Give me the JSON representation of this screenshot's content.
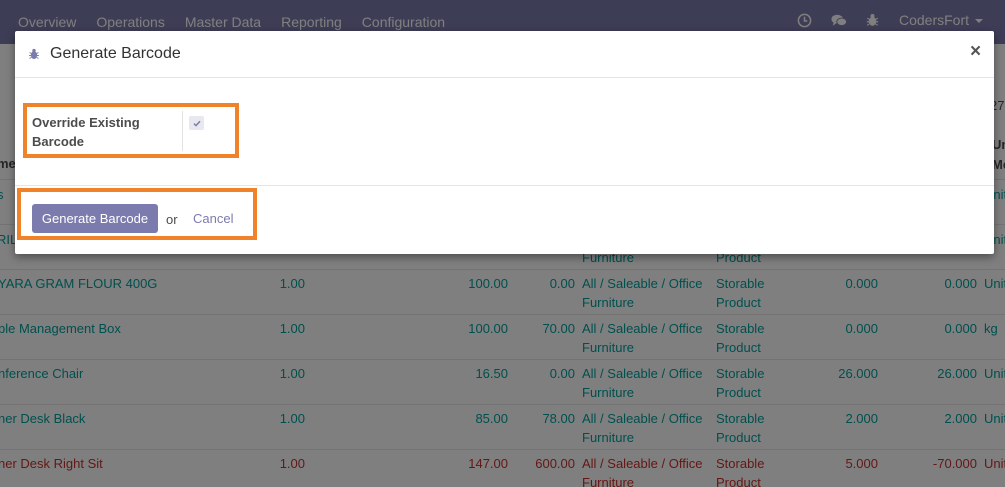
{
  "navbar": {
    "menu": [
      "Overview",
      "Operations",
      "Master Data",
      "Reporting",
      "Configuration"
    ],
    "user": "CodersFort"
  },
  "background": {
    "control_panel_fragment": "27",
    "header_fragments": {
      "left": "me",
      "right_top": "Uni",
      "right_bottom": "Mea"
    },
    "rows_fragments": [
      {
        "col_left": "s",
        "col_right": "Unit"
      },
      {
        "col_left": "RIL",
        "col_right": "Unit",
        "categ_2": "Furniture",
        "type_2": "Product"
      }
    ],
    "rows": [
      {
        "name": "YARA GRAM FLOUR 400G",
        "qty": "1.00",
        "price": "100.00",
        "cost": "0.00",
        "categ_1": "All / Saleable / Office",
        "categ_2": "Furniture",
        "type_1": "Storable",
        "type_2": "Product",
        "onhand": "0.000",
        "forecast": "0.000",
        "uom": "Unit",
        "red": false
      },
      {
        "name": "ble Management Box",
        "qty": "1.00",
        "price": "100.00",
        "cost": "70.00",
        "categ_1": "All / Saleable / Office",
        "categ_2": "Furniture",
        "type_1": "Storable",
        "type_2": "Product",
        "onhand": "0.000",
        "forecast": "0.000",
        "uom": "kg",
        "red": false
      },
      {
        "name": "nference Chair",
        "qty": "1.00",
        "price": "16.50",
        "cost": "0.00",
        "categ_1": "All / Saleable / Office",
        "categ_2": "Furniture",
        "type_1": "Storable",
        "type_2": "Product",
        "onhand": "26.000",
        "forecast": "26.000",
        "uom": "Unit",
        "red": false
      },
      {
        "name": "ner Desk Black",
        "qty": "1.00",
        "price": "85.00",
        "cost": "78.00",
        "categ_1": "All / Saleable / Office",
        "categ_2": "Furniture",
        "type_1": "Storable",
        "type_2": "Product",
        "onhand": "2.000",
        "forecast": "2.000",
        "uom": "Unit",
        "red": false
      },
      {
        "name": "ner Desk Right Sit",
        "qty": "1.00",
        "price": "147.00",
        "cost": "600.00",
        "categ_1": "All / Saleable / Office",
        "categ_2": "Furniture",
        "type_1": "Storable",
        "type_2": "Product",
        "onhand": "5.000",
        "forecast": "-70.000",
        "uom": "Unit",
        "red": true
      }
    ]
  },
  "modal": {
    "title": "Generate Barcode",
    "close": "×",
    "field_label": "Override Existing Barcode",
    "field_checked": true,
    "primary_button": "Generate Barcode",
    "or_text": "or",
    "cancel_link": "Cancel"
  },
  "colors": {
    "brand": "#7c7bad",
    "link": "#00a09d",
    "danger": "#c9302c",
    "annotation": "#f0822a"
  }
}
